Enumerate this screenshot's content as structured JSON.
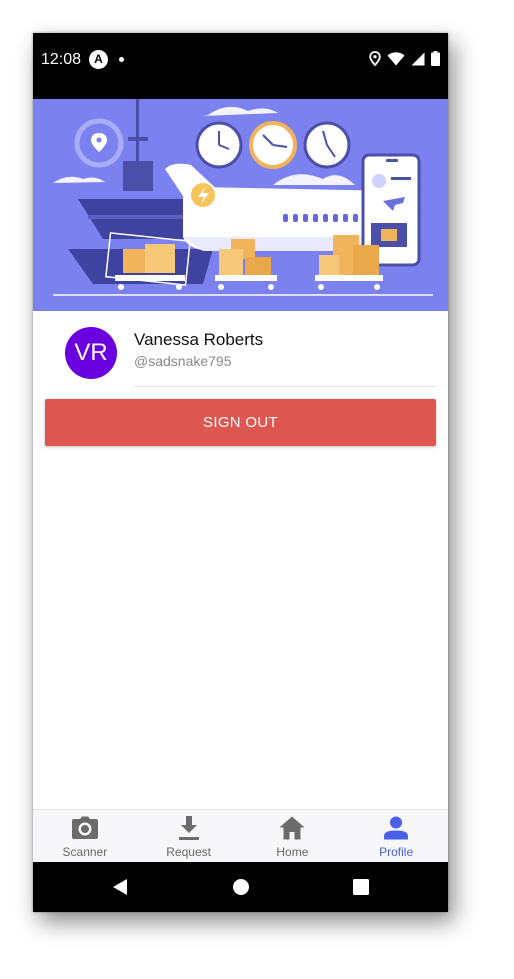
{
  "status_bar": {
    "time": "12:08",
    "app_icon_letter": "A"
  },
  "profile": {
    "initials": "VR",
    "name": "Vanessa Roberts",
    "handle": "@sadsnake795",
    "avatar_color": "#6a00e0"
  },
  "actions": {
    "sign_out_label": "SIGN OUT",
    "sign_out_color": "#dd5650"
  },
  "tabs": [
    {
      "label": "Scanner",
      "icon": "camera-icon",
      "active": false
    },
    {
      "label": "Request",
      "icon": "download-icon",
      "active": false
    },
    {
      "label": "Home",
      "icon": "home-icon",
      "active": false
    },
    {
      "label": "Profile",
      "icon": "person-icon",
      "active": true
    }
  ],
  "colors": {
    "accent": "#4a5ee8",
    "banner": "#7b82ef"
  }
}
